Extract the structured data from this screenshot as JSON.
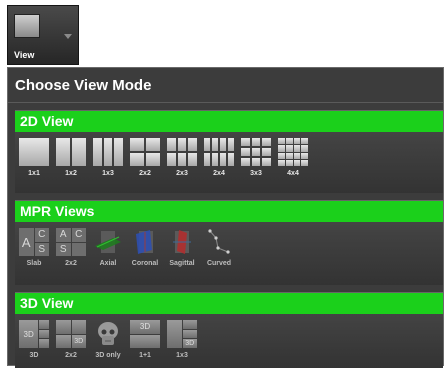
{
  "toolbar": {
    "view_label": "View"
  },
  "panel": {
    "title": "Choose View Mode"
  },
  "sections": [
    {
      "title": "2D View",
      "items": [
        {
          "label": "1x1"
        },
        {
          "label": "1x2"
        },
        {
          "label": "1x3"
        },
        {
          "label": "2x2"
        },
        {
          "label": "2x3"
        },
        {
          "label": "2x4"
        },
        {
          "label": "3x3"
        },
        {
          "label": "4x4"
        }
      ]
    },
    {
      "title": "MPR Views",
      "items": [
        {
          "label": "Slab"
        },
        {
          "label": "2x2"
        },
        {
          "label": "Axial"
        },
        {
          "label": "Coronal"
        },
        {
          "label": "Sagittal"
        },
        {
          "label": "Curved"
        }
      ],
      "icon_letters": {
        "a": "A",
        "c": "C",
        "s": "S"
      }
    },
    {
      "title": "3D View",
      "items": [
        {
          "label": "3D"
        },
        {
          "label": "2x2"
        },
        {
          "label": "3D only"
        },
        {
          "label": "1+1"
        },
        {
          "label": "1x3"
        }
      ],
      "icon_text": "3D"
    }
  ],
  "colors": {
    "section_header": "#1bd01b",
    "panel_bg": "#3c3c3c"
  }
}
